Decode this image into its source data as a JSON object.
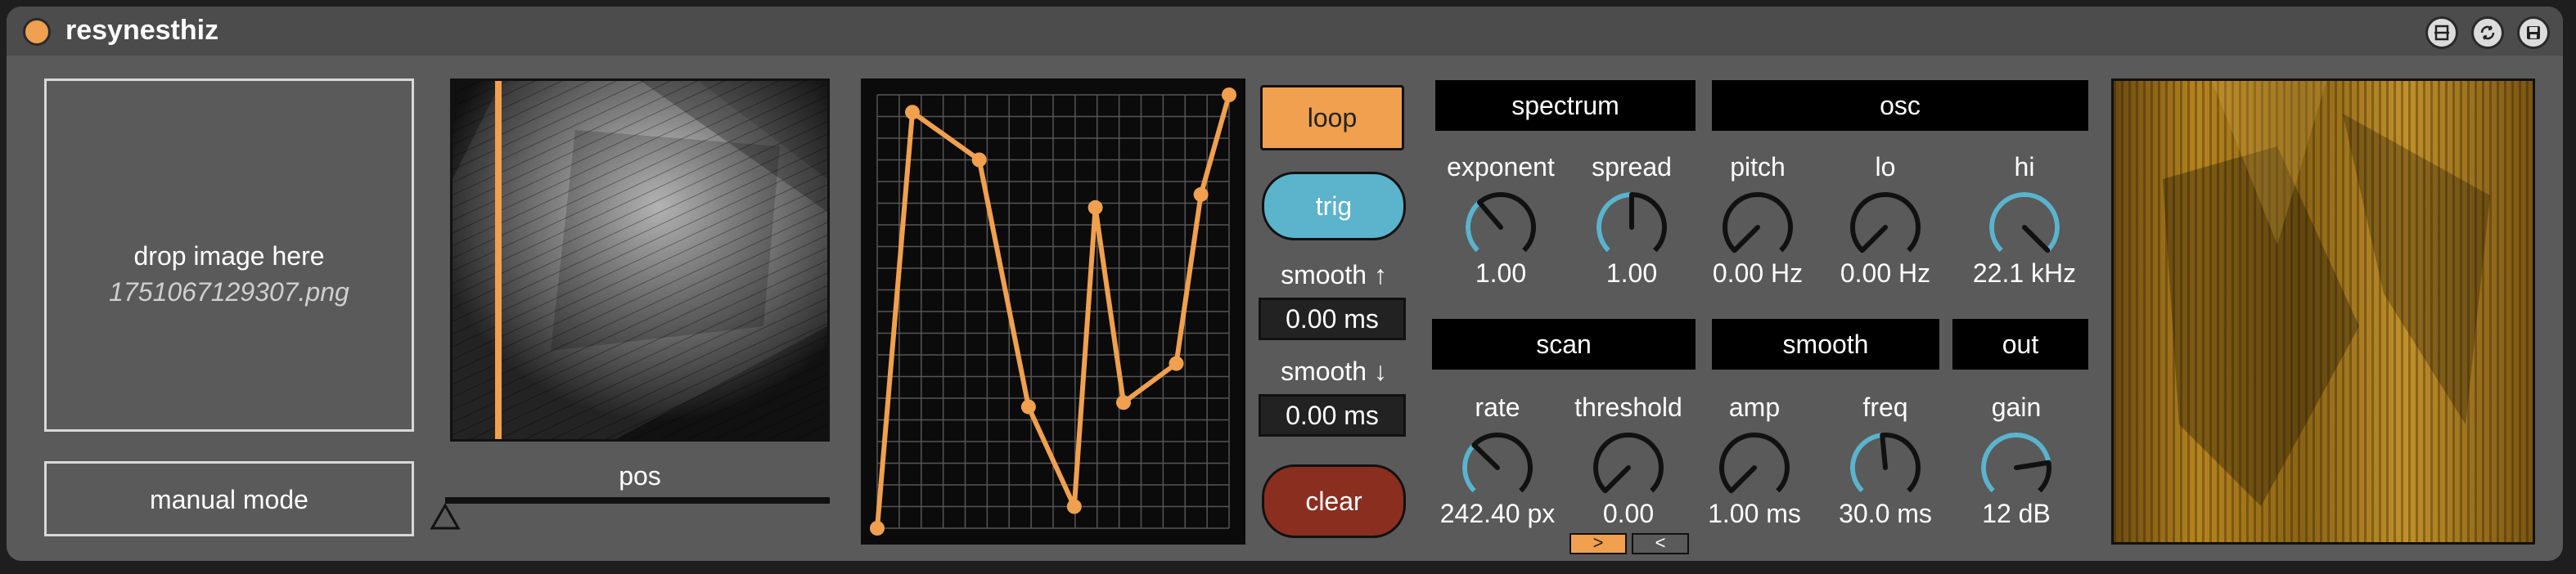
{
  "device": {
    "title": "resynesthiz",
    "icons": [
      "preset-icon",
      "hot-swap-icon",
      "save-icon"
    ]
  },
  "drop": {
    "label": "drop image here",
    "filename": "1751067129307.png"
  },
  "manual_mode": {
    "label": "manual mode"
  },
  "pos": {
    "label": "pos",
    "value": 0.0
  },
  "buttons": {
    "loop": "loop",
    "trig": "trig",
    "clear": "clear"
  },
  "smooth_up": {
    "label": "smooth ↑",
    "value": "0.00 ms"
  },
  "smooth_down": {
    "label": "smooth ↓",
    "value": "0.00 ms"
  },
  "sections": {
    "spectrum": "spectrum",
    "osc": "osc",
    "scan": "scan",
    "smooth": "smooth",
    "out": "out"
  },
  "knobs": {
    "exponent": {
      "label": "exponent",
      "value": "1.00",
      "level": 0.35
    },
    "spread": {
      "label": "spread",
      "value": "1.00",
      "level": 0.5
    },
    "pitch": {
      "label": "pitch",
      "value": "0.00 Hz",
      "level": 0.0
    },
    "lo": {
      "label": "lo",
      "value": "0.00 Hz",
      "level": 0.0
    },
    "hi": {
      "label": "hi",
      "value": "22.1 kHz",
      "level": 1.0
    },
    "rate": {
      "label": "rate",
      "value": "242.40 px",
      "level": 0.33
    },
    "threshold": {
      "label": "threshold",
      "value": "0.00",
      "level": 0.0
    },
    "amp": {
      "label": "amp",
      "value": "1.00 ms",
      "level": 0.0
    },
    "freq": {
      "label": "freq",
      "value": "30.0 ms",
      "level": 0.48
    },
    "gain": {
      "label": "gain",
      "value": "12 dB",
      "level": 0.8
    }
  },
  "direction": {
    "forward": ">",
    "backward": "<"
  },
  "curve": {
    "points": [
      [
        0.0,
        0.0
      ],
      [
        0.1,
        0.96
      ],
      [
        0.29,
        0.85
      ],
      [
        0.43,
        0.28
      ],
      [
        0.56,
        0.05
      ],
      [
        0.62,
        0.74
      ],
      [
        0.7,
        0.29
      ],
      [
        0.85,
        0.38
      ],
      [
        0.92,
        0.77
      ],
      [
        1.0,
        1.0
      ]
    ]
  },
  "colors": {
    "accent_orange": "#f0a04e",
    "accent_blue": "#5bb3cc",
    "clear_red": "#8a2e1f",
    "panel": "#5a5a5a",
    "dark": "#0b0b0b"
  }
}
